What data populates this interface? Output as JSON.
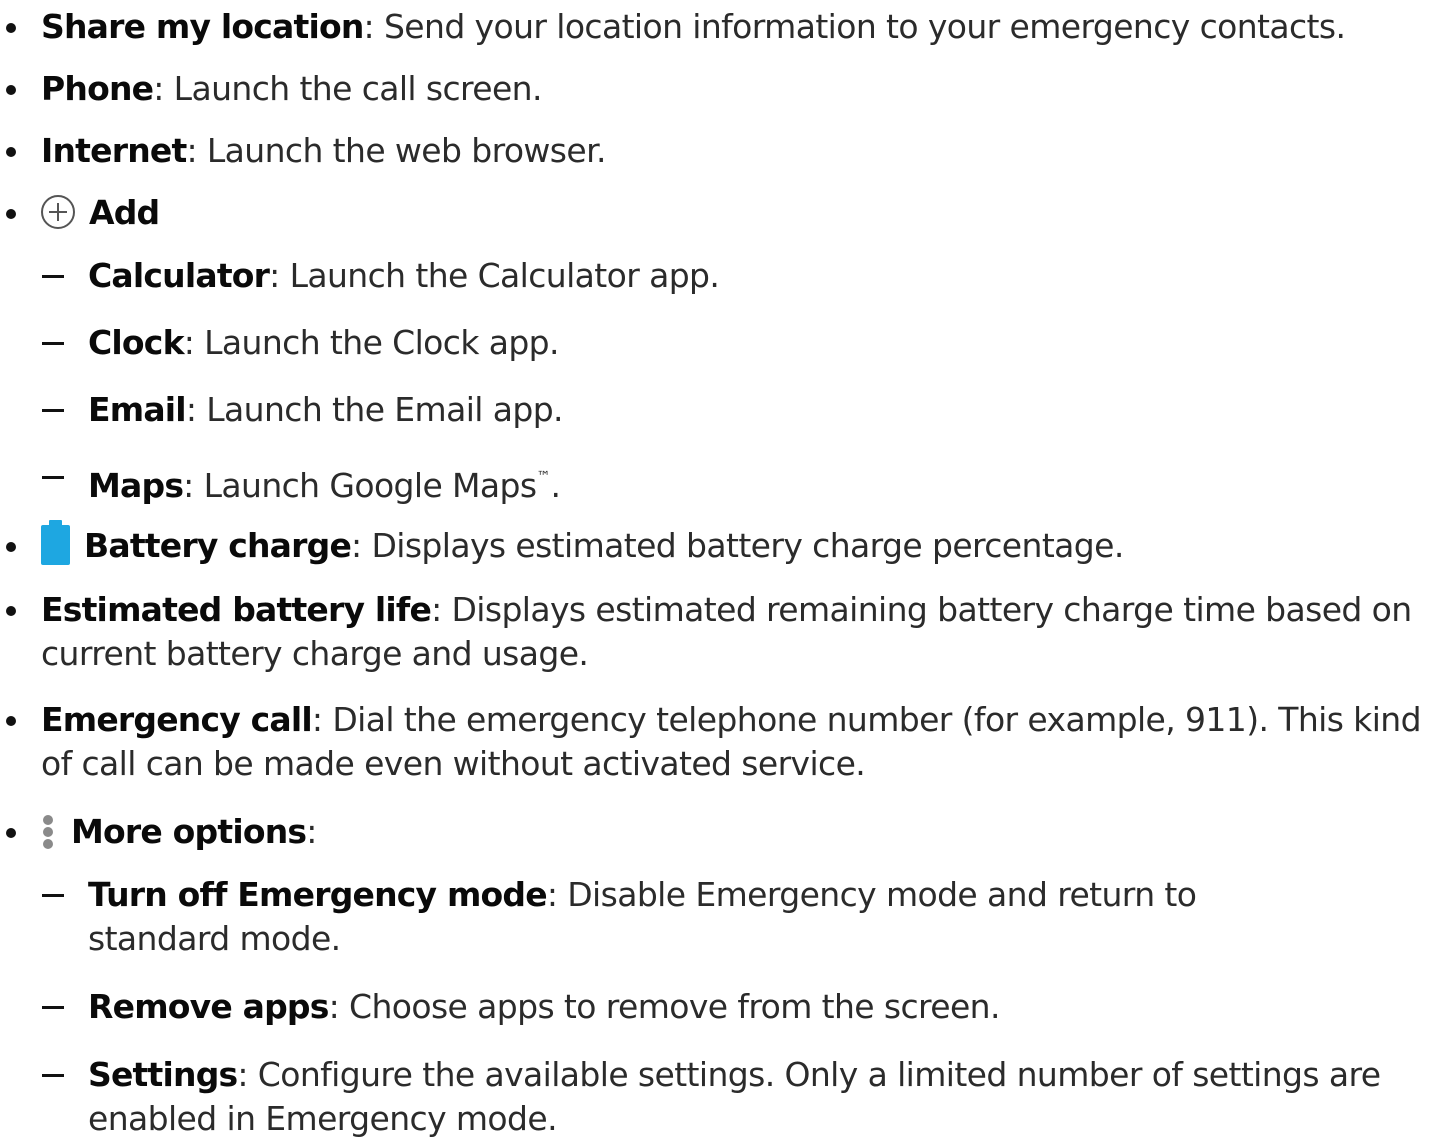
{
  "items": [
    {
      "term": "Share my location",
      "sep": ": ",
      "desc": "Send your location information to your emergency contacts."
    },
    {
      "term": "Phone",
      "sep": ": ",
      "desc": "Launch the call screen."
    },
    {
      "term": "Internet",
      "sep": ": ",
      "desc": "Launch the web browser."
    },
    {
      "term": "Add",
      "icon": "add-circle-icon",
      "subitems": [
        {
          "term": "Calculator",
          "sep": ": ",
          "desc": "Launch the Calculator app."
        },
        {
          "term": "Clock",
          "sep": ": ",
          "desc": "Launch the Clock app."
        },
        {
          "term": "Email",
          "sep": ": ",
          "desc": "Launch the Email app."
        },
        {
          "term": "Maps",
          "sep": ": ",
          "desc": "Launch Google Maps",
          "tm": "™",
          "end": "."
        }
      ]
    },
    {
      "term": "Battery charge",
      "icon": "battery-icon",
      "sep": ": ",
      "desc": "Displays estimated battery charge percentage."
    },
    {
      "term": "Estimated battery life",
      "sep": ": ",
      "desc": "Displays estimated remaining battery charge time based on",
      "desc2": "current battery charge and usage."
    },
    {
      "term": "Emergency call",
      "sep": ": ",
      "desc": "Dial the emergency telephone number (for example, 911). This kind",
      "desc2": "of call can be made even without activated service."
    },
    {
      "term": "More options",
      "icon": "more-options-icon",
      "sep": ":",
      "subitems": [
        {
          "term": "Turn off Emergency mode",
          "sep": ": ",
          "desc": "Disable Emergency mode and return to",
          "desc2": "standard mode."
        },
        {
          "term": "Remove apps",
          "sep": ": ",
          "desc": "Choose apps to remove from the screen."
        },
        {
          "term": "Settings",
          "sep": ": ",
          "desc": "Configure the available settings. Only a limited number of settings are",
          "desc2": "enabled in Emergency mode."
        }
      ]
    }
  ],
  "colors": {
    "battery_icon": "#1ea7e1",
    "more_icon": "#8a8a8a",
    "text": "#212121"
  }
}
